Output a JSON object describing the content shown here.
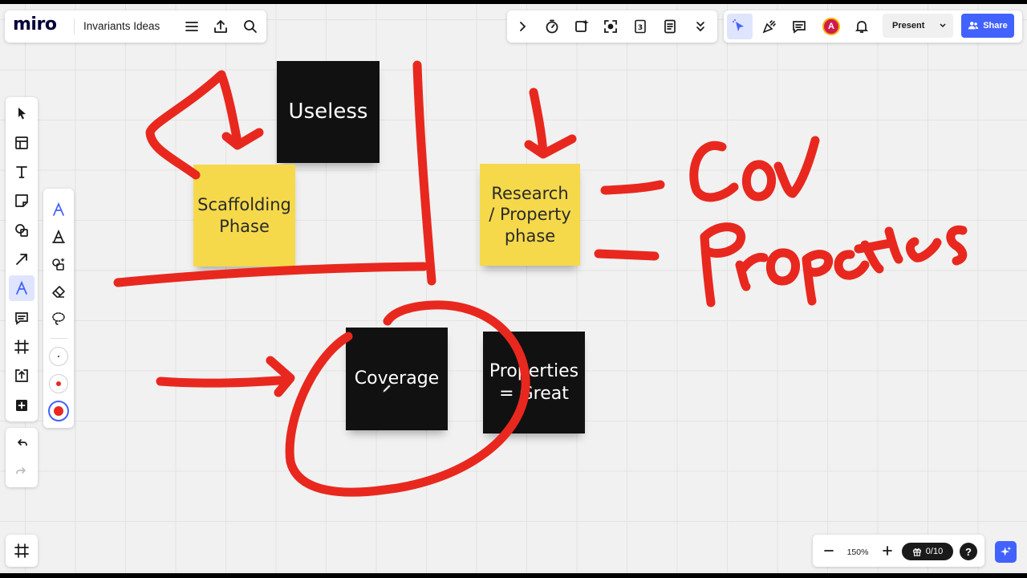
{
  "app": {
    "logo": "miro",
    "board_title": "Invariants Ideas"
  },
  "toolbar_right": {
    "present_label": "Present",
    "share_label": "Share",
    "avatar_initial": "A"
  },
  "stickies": {
    "useless": "Useless",
    "scaffolding": "Scaffolding Phase",
    "research": "Research / Property phase",
    "coverage": "Coverage",
    "properties": "Properties = Great"
  },
  "bottom_bar": {
    "zoom": "150%",
    "counter": "0/10"
  },
  "colors": {
    "accent": "#4262ff",
    "ink": "#e8281e",
    "sticky_yellow": "#f5d94a",
    "sticky_black": "#111111"
  }
}
